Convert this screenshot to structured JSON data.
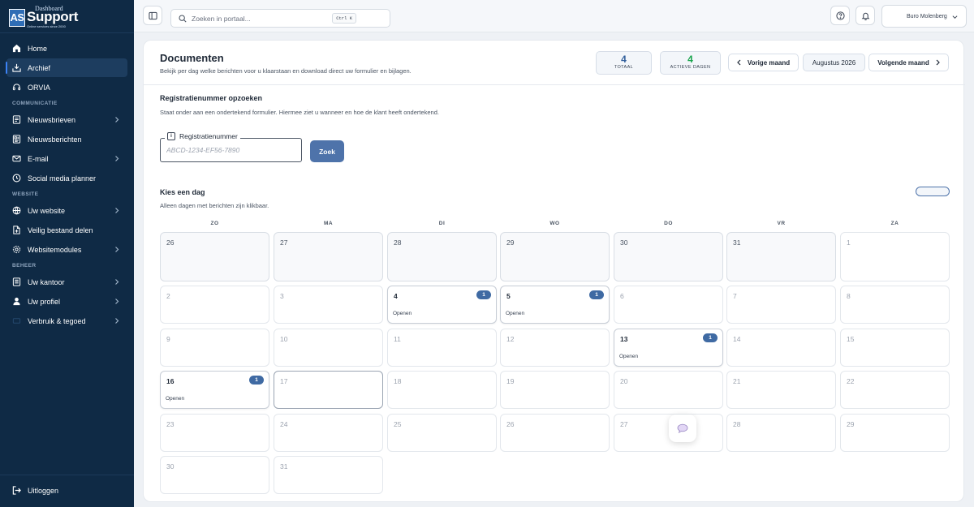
{
  "brand": {
    "logo_letters": "AS",
    "logo_top": "Dashboard",
    "logo_main": "Support",
    "logo_sub": "Online services since 2000"
  },
  "sidebar": {
    "items": [
      {
        "label": "Home",
        "icon": "home-icon"
      },
      {
        "label": "Archief",
        "icon": "archive-icon",
        "active": true
      },
      {
        "label": "ORVIA",
        "icon": "headset-icon"
      }
    ],
    "sections": [
      {
        "title": "COMMUNICATIE",
        "items": [
          {
            "label": "Nieuwsbrieven",
            "icon": "newsletter-icon",
            "chevron": true
          },
          {
            "label": "Nieuwsberichten",
            "icon": "news-icon"
          },
          {
            "label": "E-mail",
            "icon": "mail-icon",
            "chevron": true
          },
          {
            "label": "Social media planner",
            "icon": "clock-icon"
          }
        ]
      },
      {
        "title": "WEBSITE",
        "items": [
          {
            "label": "Uw website",
            "icon": "globe-icon",
            "chevron": true
          },
          {
            "label": "Veilig bestand delen",
            "icon": "file-share-icon"
          },
          {
            "label": "Websitemodules",
            "icon": "gear-icon",
            "chevron": true
          }
        ]
      },
      {
        "title": "BEHEER",
        "items": [
          {
            "label": "Uw kantoor",
            "icon": "office-icon",
            "chevron": true
          },
          {
            "label": "Uw profiel",
            "icon": "user-icon",
            "chevron": true
          },
          {
            "label": "Verbruik & tegoed",
            "icon": "usage-icon",
            "chevron": true
          }
        ]
      }
    ],
    "logout_label": "Uitloggen"
  },
  "topbar": {
    "search_placeholder": "Zoeken in portaal...",
    "search_shortcut": "Ctrl K",
    "account_name": "Buro Molenberg"
  },
  "page": {
    "title": "Documenten",
    "subtitle": "Bekijk per dag welke berichten voor u klaarstaan en download direct uw formulier en bijlagen.",
    "stats": [
      {
        "value": "4",
        "label": "TOTAAL",
        "color": "#2f5d9a"
      },
      {
        "value": "4",
        "label": "ACTIEVE DAGEN",
        "color": "#16a34a"
      }
    ],
    "prev_month_label": "Vorige maand",
    "current_month": "Augustus 2026",
    "next_month_label": "Volgende maand"
  },
  "lookup": {
    "title": "Registratienummer opzoeken",
    "subtitle": "Staat onder aan een ondertekend formulier. Hiermee ziet u wanneer en hoe de klant heeft ondertekend.",
    "field_label": "Registratienummer",
    "field_placeholder": "ABCD-1234-EF56-7890",
    "button_label": "Zoek"
  },
  "calendar": {
    "title": "Kies een dag",
    "subtitle": "Alleen dagen met berichten zijn klikbaar.",
    "weekdays": [
      "ZO",
      "MA",
      "DI",
      "WO",
      "DO",
      "VR",
      "ZA"
    ],
    "open_label": "Openen",
    "weeks": [
      [
        {
          "n": "26",
          "prev": true
        },
        {
          "n": "27",
          "prev": true
        },
        {
          "n": "28",
          "prev": true
        },
        {
          "n": "29",
          "prev": true
        },
        {
          "n": "30",
          "prev": true
        },
        {
          "n": "31",
          "prev": true
        },
        {
          "n": "1"
        }
      ],
      [
        {
          "n": "2"
        },
        {
          "n": "3"
        },
        {
          "n": "4",
          "count": "1"
        },
        {
          "n": "5",
          "count": "1"
        },
        {
          "n": "6"
        },
        {
          "n": "7"
        },
        {
          "n": "8"
        }
      ],
      [
        {
          "n": "9"
        },
        {
          "n": "10"
        },
        {
          "n": "11"
        },
        {
          "n": "12"
        },
        {
          "n": "13",
          "count": "1"
        },
        {
          "n": "14"
        },
        {
          "n": "15"
        }
      ],
      [
        {
          "n": "16",
          "count": "1"
        },
        {
          "n": "17",
          "today": true
        },
        {
          "n": "18"
        },
        {
          "n": "19"
        },
        {
          "n": "20"
        },
        {
          "n": "21"
        },
        {
          "n": "22"
        }
      ],
      [
        {
          "n": "23"
        },
        {
          "n": "24"
        },
        {
          "n": "25"
        },
        {
          "n": "26"
        },
        {
          "n": "27"
        },
        {
          "n": "28"
        },
        {
          "n": "29"
        }
      ],
      [
        {
          "n": "30"
        },
        {
          "n": "31"
        }
      ]
    ]
  },
  "colors": {
    "sidebar_bg": "#0f2a45",
    "accent": "#4e73aa",
    "badge": "#3f6aa3",
    "active_days": "#16a34a"
  }
}
